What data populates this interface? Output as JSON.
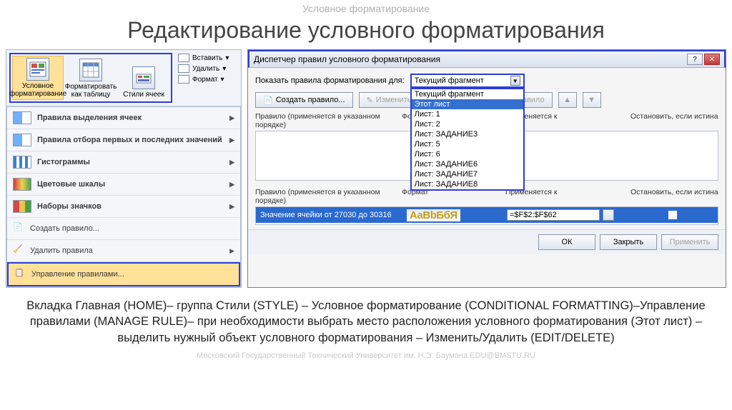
{
  "slide": {
    "header": "Условное форматирование",
    "title": "Редактирование условного форматирования"
  },
  "ribbon": {
    "styles": {
      "cond_fmt": "Условное форматирование",
      "fmt_table": "Форматировать как таблицу",
      "cell_styles": "Стили ячеек"
    },
    "cells": {
      "insert": "Вставить",
      "delete": "Удалить",
      "format": "Формат"
    }
  },
  "cf_menu": {
    "highlight": "Правила выделения ячеек",
    "topbottom": "Правила отбора первых и последних значений",
    "databars": "Гистограммы",
    "colorscales": "Цветовые шкалы",
    "iconsets": "Наборы значков",
    "new_rule": "Создать правило...",
    "clear": "Удалить правила",
    "manage": "Управление правилами..."
  },
  "dialog": {
    "title": "Диспетчер правил условного форматирования",
    "show_rules_for": "Показать правила форматирования для:",
    "selected": "Текущий фрагмент",
    "options": [
      "Текущий фрагмент",
      "Этот лист",
      "Лист: 1",
      "Лист: 2",
      "Лист: ЗАДАНИЕ3",
      "Лист: 5",
      "Лист: 6",
      "Лист: ЗАДАНИЕ6",
      "Лист: ЗАДАНИЕ7",
      "Лист: ЗАДАНИЕ8"
    ],
    "btn_new": "Создать правило...",
    "btn_edit": "Изменить правило...",
    "btn_delete": "Удалить правило",
    "col_rule": "Правило (применяется в указанном порядке)",
    "col_format": "Формат",
    "col_applies": "Применяется к",
    "col_stop": "Остановить, если истина",
    "rule1_text": "Значение ячейки от 27030 до 30316",
    "rule1_preview": "АаВbБбЯ",
    "rule1_range": "=$F$2:$F$62",
    "footer_ok": "ОК",
    "footer_close": "Закрыть",
    "footer_apply": "Применить"
  },
  "desc": "Вкладка Главная (HOME)– группа Стили (STYLE) – Условное форматирование (CONDITIONAL FORMATTING)–Управление правилами (MANAGE RULE)– при необходимости выбрать место расположения условного форматирования (Этот лист) –выделить нужный объект условного форматирования – Изменить/Удалить (EDIT/DELETE)",
  "footer": "Московский Государственный Технический Университет им. Н.Э. Баумана EDU@BMSTU.RU"
}
